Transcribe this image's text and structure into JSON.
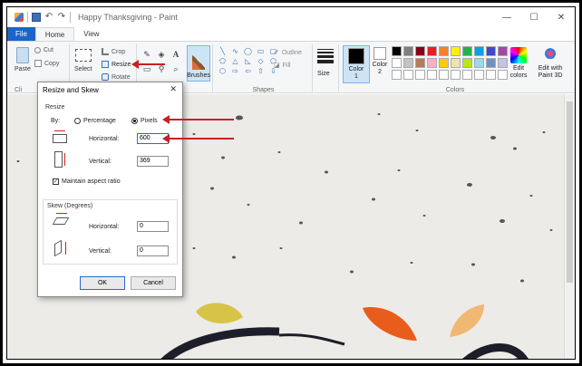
{
  "window": {
    "title": "Happy Thanksgiving - Paint",
    "minimize": "—",
    "maximize": "☐",
    "close": "✕"
  },
  "tabs": [
    {
      "label": "File"
    },
    {
      "label": "Home"
    },
    {
      "label": "View"
    }
  ],
  "ribbon": {
    "clipboard": {
      "paste": "Paste",
      "cut": "Cut",
      "copy": "Copy",
      "group_label": "Cli"
    },
    "image": {
      "select": "Select",
      "crop": "Crop",
      "resize": "Resize",
      "rotate": "Rotate"
    },
    "tools": {
      "brushes": "Brushes"
    },
    "shapes": {
      "outline": "Outline",
      "fill": "Fill",
      "group_label": "Shapes"
    },
    "size": {
      "label": "Size"
    },
    "colors": {
      "color1": "Color 1",
      "color2": "Color 2",
      "edit_colors": "Edit colors",
      "paint3d": "Edit with Paint 3D",
      "group_label": "Colors",
      "color1_value": "#000000",
      "color2_value": "#ffffff",
      "palette": [
        "#000000",
        "#7f7f7f",
        "#880015",
        "#ed1c24",
        "#ff7f27",
        "#fff200",
        "#22b14c",
        "#00a2e8",
        "#3f48cc",
        "#a349a4",
        "#ffffff",
        "#c3c3c3",
        "#b97a57",
        "#ffaec9",
        "#ffc90e",
        "#efe4b0",
        "#b5e61d",
        "#99d9ea",
        "#7092be",
        "#c8bfe7",
        "#ffffff",
        "#ffffff",
        "#ffffff",
        "#ffffff",
        "#ffffff",
        "#ffffff",
        "#ffffff",
        "#ffffff",
        "#ffffff",
        "#ffffff"
      ]
    }
  },
  "dialog": {
    "title": "Resize and Skew",
    "close": "✕",
    "resize_section": "Resize",
    "by_label": "By:",
    "percentage": "Percentage",
    "pixels": "Pixels",
    "horizontal_label": "Horizontal:",
    "horizontal_value": "600",
    "vertical_label": "Vertical:",
    "vertical_value": "369",
    "maintain_aspect": "Maintain aspect ratio",
    "skew_section": "Skew (Degrees)",
    "skew_horizontal_label": "Horizontal:",
    "skew_horizontal_value": "0",
    "skew_vertical_label": "Vertical:",
    "skew_vertical_value": "0",
    "ok": "OK",
    "cancel": "Cancel"
  },
  "icons": {
    "undo": "↶",
    "redo": "↷",
    "text_tool": "A",
    "check": "✓"
  }
}
